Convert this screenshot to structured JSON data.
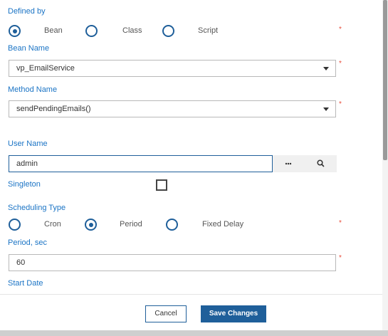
{
  "defined_by": {
    "label": "Defined by",
    "required_mark": "*",
    "options": [
      {
        "label": "Bean",
        "checked": true
      },
      {
        "label": "Class",
        "checked": false
      },
      {
        "label": "Script",
        "checked": false
      }
    ]
  },
  "bean_name": {
    "label": "Bean Name",
    "value": "vp_EmailService",
    "required_mark": "*"
  },
  "method_name": {
    "label": "Method Name",
    "value": "sendPendingEmails()",
    "required_mark": "*"
  },
  "user_name": {
    "label": "User Name",
    "value": "admin",
    "more_icon": "ellipsis-icon",
    "search_icon": "search-icon"
  },
  "singleton": {
    "label": "Singleton",
    "checked": false
  },
  "scheduling_type": {
    "label": "Scheduling Type",
    "required_mark": "*",
    "options": [
      {
        "label": "Cron",
        "checked": false
      },
      {
        "label": "Period",
        "checked": true
      },
      {
        "label": "Fixed Delay",
        "checked": false
      }
    ]
  },
  "period": {
    "label": "Period, sec",
    "value": "60",
    "required_mark": "*"
  },
  "start_date": {
    "label": "Start Date"
  },
  "footer": {
    "cancel_label": "Cancel",
    "save_label": "Save Changes"
  },
  "colors": {
    "accent": "#1f5f9a",
    "label": "#1b74c5",
    "required": "#e84d3c"
  }
}
